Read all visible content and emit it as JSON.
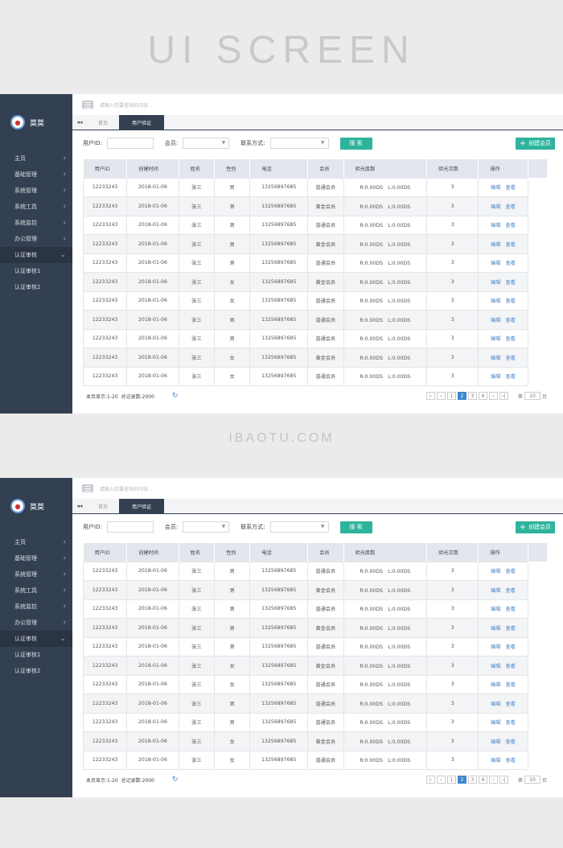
{
  "hero_title": "UI SCREEN",
  "watermark": "IBAOTU.COM",
  "user": {
    "name": "莫莫"
  },
  "menu": [
    {
      "label": "主页",
      "chevron": "‹"
    },
    {
      "label": "基础管理",
      "chevron": "‹"
    },
    {
      "label": "系统管理",
      "chevron": "‹"
    },
    {
      "label": "系统工具",
      "chevron": "‹"
    },
    {
      "label": "系统监控",
      "chevron": "‹"
    },
    {
      "label": "办公管理",
      "chevron": "‹"
    },
    {
      "label": "认证审核",
      "chevron": "⌄"
    }
  ],
  "submenu": [
    "认证审核1",
    "认证审核2"
  ],
  "search_hint": "请输入您要查询的内容...",
  "tabs": {
    "back": "◂◂",
    "home": "首页",
    "current": "用户验证"
  },
  "filter": {
    "user_id_label": "用户ID:",
    "member_label": "会员:",
    "contact_label": "联系方式:",
    "search_btn": "搜 索",
    "create_btn": "创建会员",
    "plus": "+"
  },
  "table": {
    "headers": [
      "用户ID",
      "创建时间",
      "姓名",
      "性别",
      "电话",
      "会员",
      "验光度数",
      "验光次数",
      "操作"
    ],
    "rows": [
      [
        "12233243",
        "2018-01-06",
        "张三",
        "男",
        "13256897685",
        "普通会员",
        "R:0.00DS　L:0.00DS",
        "3"
      ],
      [
        "12233243",
        "2018-01-06",
        "张三",
        "男",
        "13256897685",
        "黄金会员",
        "R:0.00DS　L:0.00DS",
        "3"
      ],
      [
        "12233243",
        "2018-01-06",
        "张三",
        "男",
        "13256897685",
        "普通会员",
        "R:0.00DS　L:0.00DS",
        "3"
      ],
      [
        "12233243",
        "2018-01-06",
        "张三",
        "男",
        "13256897685",
        "黄金会员",
        "R:0.00DS　L:0.00DS",
        "3"
      ],
      [
        "12233243",
        "2018-01-06",
        "张三",
        "男",
        "13256897685",
        "普通会员",
        "R:0.00DS　L:0.00DS",
        "3"
      ],
      [
        "12233243",
        "2018-01-06",
        "张三",
        "女",
        "13256897685",
        "黄金会员",
        "R:0.00DS　L:0.00DS",
        "3"
      ],
      [
        "12233243",
        "2018-01-06",
        "张三",
        "女",
        "13256897685",
        "普通会员",
        "R:0.00DS　L:0.00DS",
        "3"
      ],
      [
        "12233243",
        "2018-01-06",
        "张三",
        "男",
        "13256897685",
        "普通会员",
        "R:0.00DS　L:0.00DS",
        "3"
      ],
      [
        "12233243",
        "2018-01-06",
        "张三",
        "男",
        "13256897685",
        "普通会员",
        "R:0.00DS　L:0.00DS",
        "3"
      ],
      [
        "12233243",
        "2018-01-06",
        "张三",
        "女",
        "13256897685",
        "黄金会员",
        "R:0.00DS　L:0.00DS",
        "3"
      ],
      [
        "12233243",
        "2018-01-06",
        "张三",
        "女",
        "13256897685",
        "普通会员",
        "R:0.00DS　L:0.00DS",
        "3"
      ]
    ],
    "edit": "编辑",
    "view": "查看"
  },
  "footer": {
    "page_info": "本页显示:1-20",
    "total": "总记录数:2000",
    "refresh": "↻"
  },
  "pager": {
    "first": "|‹",
    "prev": "‹",
    "pages": [
      "1",
      "2",
      "3",
      "4"
    ],
    "current_page": "2",
    "next": "›",
    "last": "›|",
    "goto_label": "第",
    "goto_value": "10",
    "goto_unit": "页"
  },
  "colors": {
    "sidebar": "#334051",
    "accent": "#2eb39c",
    "link": "#4a86c5"
  }
}
